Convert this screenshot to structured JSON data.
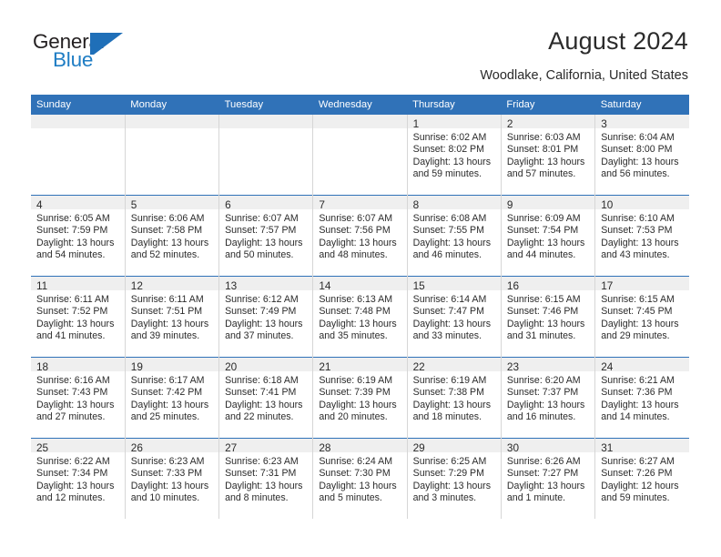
{
  "brand": {
    "name_part1": "General",
    "name_part2": "Blue"
  },
  "header": {
    "title": "August 2024",
    "subtitle": "Woodlake, California, United States"
  },
  "colors": {
    "header_blue": "#3072b8",
    "brand_blue": "#1f7dc4",
    "daynum_background": "#efefef",
    "cell_divider": "#d6d6d6"
  },
  "weekday_headers": [
    "Sunday",
    "Monday",
    "Tuesday",
    "Wednesday",
    "Thursday",
    "Friday",
    "Saturday"
  ],
  "weeks": [
    [
      {
        "day": "",
        "sunrise": "",
        "sunset": "",
        "daylight_line1": "",
        "daylight_line2": "",
        "empty": true
      },
      {
        "day": "",
        "sunrise": "",
        "sunset": "",
        "daylight_line1": "",
        "daylight_line2": "",
        "empty": true
      },
      {
        "day": "",
        "sunrise": "",
        "sunset": "",
        "daylight_line1": "",
        "daylight_line2": "",
        "empty": true
      },
      {
        "day": "",
        "sunrise": "",
        "sunset": "",
        "daylight_line1": "",
        "daylight_line2": "",
        "empty": true
      },
      {
        "day": "1",
        "sunrise": "Sunrise: 6:02 AM",
        "sunset": "Sunset: 8:02 PM",
        "daylight_line1": "Daylight: 13 hours",
        "daylight_line2": "and 59 minutes."
      },
      {
        "day": "2",
        "sunrise": "Sunrise: 6:03 AM",
        "sunset": "Sunset: 8:01 PM",
        "daylight_line1": "Daylight: 13 hours",
        "daylight_line2": "and 57 minutes."
      },
      {
        "day": "3",
        "sunrise": "Sunrise: 6:04 AM",
        "sunset": "Sunset: 8:00 PM",
        "daylight_line1": "Daylight: 13 hours",
        "daylight_line2": "and 56 minutes."
      }
    ],
    [
      {
        "day": "4",
        "sunrise": "Sunrise: 6:05 AM",
        "sunset": "Sunset: 7:59 PM",
        "daylight_line1": "Daylight: 13 hours",
        "daylight_line2": "and 54 minutes."
      },
      {
        "day": "5",
        "sunrise": "Sunrise: 6:06 AM",
        "sunset": "Sunset: 7:58 PM",
        "daylight_line1": "Daylight: 13 hours",
        "daylight_line2": "and 52 minutes."
      },
      {
        "day": "6",
        "sunrise": "Sunrise: 6:07 AM",
        "sunset": "Sunset: 7:57 PM",
        "daylight_line1": "Daylight: 13 hours",
        "daylight_line2": "and 50 minutes."
      },
      {
        "day": "7",
        "sunrise": "Sunrise: 6:07 AM",
        "sunset": "Sunset: 7:56 PM",
        "daylight_line1": "Daylight: 13 hours",
        "daylight_line2": "and 48 minutes."
      },
      {
        "day": "8",
        "sunrise": "Sunrise: 6:08 AM",
        "sunset": "Sunset: 7:55 PM",
        "daylight_line1": "Daylight: 13 hours",
        "daylight_line2": "and 46 minutes."
      },
      {
        "day": "9",
        "sunrise": "Sunrise: 6:09 AM",
        "sunset": "Sunset: 7:54 PM",
        "daylight_line1": "Daylight: 13 hours",
        "daylight_line2": "and 44 minutes."
      },
      {
        "day": "10",
        "sunrise": "Sunrise: 6:10 AM",
        "sunset": "Sunset: 7:53 PM",
        "daylight_line1": "Daylight: 13 hours",
        "daylight_line2": "and 43 minutes."
      }
    ],
    [
      {
        "day": "11",
        "sunrise": "Sunrise: 6:11 AM",
        "sunset": "Sunset: 7:52 PM",
        "daylight_line1": "Daylight: 13 hours",
        "daylight_line2": "and 41 minutes."
      },
      {
        "day": "12",
        "sunrise": "Sunrise: 6:11 AM",
        "sunset": "Sunset: 7:51 PM",
        "daylight_line1": "Daylight: 13 hours",
        "daylight_line2": "and 39 minutes."
      },
      {
        "day": "13",
        "sunrise": "Sunrise: 6:12 AM",
        "sunset": "Sunset: 7:49 PM",
        "daylight_line1": "Daylight: 13 hours",
        "daylight_line2": "and 37 minutes."
      },
      {
        "day": "14",
        "sunrise": "Sunrise: 6:13 AM",
        "sunset": "Sunset: 7:48 PM",
        "daylight_line1": "Daylight: 13 hours",
        "daylight_line2": "and 35 minutes."
      },
      {
        "day": "15",
        "sunrise": "Sunrise: 6:14 AM",
        "sunset": "Sunset: 7:47 PM",
        "daylight_line1": "Daylight: 13 hours",
        "daylight_line2": "and 33 minutes."
      },
      {
        "day": "16",
        "sunrise": "Sunrise: 6:15 AM",
        "sunset": "Sunset: 7:46 PM",
        "daylight_line1": "Daylight: 13 hours",
        "daylight_line2": "and 31 minutes."
      },
      {
        "day": "17",
        "sunrise": "Sunrise: 6:15 AM",
        "sunset": "Sunset: 7:45 PM",
        "daylight_line1": "Daylight: 13 hours",
        "daylight_line2": "and 29 minutes."
      }
    ],
    [
      {
        "day": "18",
        "sunrise": "Sunrise: 6:16 AM",
        "sunset": "Sunset: 7:43 PM",
        "daylight_line1": "Daylight: 13 hours",
        "daylight_line2": "and 27 minutes."
      },
      {
        "day": "19",
        "sunrise": "Sunrise: 6:17 AM",
        "sunset": "Sunset: 7:42 PM",
        "daylight_line1": "Daylight: 13 hours",
        "daylight_line2": "and 25 minutes."
      },
      {
        "day": "20",
        "sunrise": "Sunrise: 6:18 AM",
        "sunset": "Sunset: 7:41 PM",
        "daylight_line1": "Daylight: 13 hours",
        "daylight_line2": "and 22 minutes."
      },
      {
        "day": "21",
        "sunrise": "Sunrise: 6:19 AM",
        "sunset": "Sunset: 7:39 PM",
        "daylight_line1": "Daylight: 13 hours",
        "daylight_line2": "and 20 minutes."
      },
      {
        "day": "22",
        "sunrise": "Sunrise: 6:19 AM",
        "sunset": "Sunset: 7:38 PM",
        "daylight_line1": "Daylight: 13 hours",
        "daylight_line2": "and 18 minutes."
      },
      {
        "day": "23",
        "sunrise": "Sunrise: 6:20 AM",
        "sunset": "Sunset: 7:37 PM",
        "daylight_line1": "Daylight: 13 hours",
        "daylight_line2": "and 16 minutes."
      },
      {
        "day": "24",
        "sunrise": "Sunrise: 6:21 AM",
        "sunset": "Sunset: 7:36 PM",
        "daylight_line1": "Daylight: 13 hours",
        "daylight_line2": "and 14 minutes."
      }
    ],
    [
      {
        "day": "25",
        "sunrise": "Sunrise: 6:22 AM",
        "sunset": "Sunset: 7:34 PM",
        "daylight_line1": "Daylight: 13 hours",
        "daylight_line2": "and 12 minutes."
      },
      {
        "day": "26",
        "sunrise": "Sunrise: 6:23 AM",
        "sunset": "Sunset: 7:33 PM",
        "daylight_line1": "Daylight: 13 hours",
        "daylight_line2": "and 10 minutes."
      },
      {
        "day": "27",
        "sunrise": "Sunrise: 6:23 AM",
        "sunset": "Sunset: 7:31 PM",
        "daylight_line1": "Daylight: 13 hours",
        "daylight_line2": "and 8 minutes."
      },
      {
        "day": "28",
        "sunrise": "Sunrise: 6:24 AM",
        "sunset": "Sunset: 7:30 PM",
        "daylight_line1": "Daylight: 13 hours",
        "daylight_line2": "and 5 minutes."
      },
      {
        "day": "29",
        "sunrise": "Sunrise: 6:25 AM",
        "sunset": "Sunset: 7:29 PM",
        "daylight_line1": "Daylight: 13 hours",
        "daylight_line2": "and 3 minutes."
      },
      {
        "day": "30",
        "sunrise": "Sunrise: 6:26 AM",
        "sunset": "Sunset: 7:27 PM",
        "daylight_line1": "Daylight: 13 hours",
        "daylight_line2": "and 1 minute."
      },
      {
        "day": "31",
        "sunrise": "Sunrise: 6:27 AM",
        "sunset": "Sunset: 7:26 PM",
        "daylight_line1": "Daylight: 12 hours",
        "daylight_line2": "and 59 minutes."
      }
    ]
  ]
}
